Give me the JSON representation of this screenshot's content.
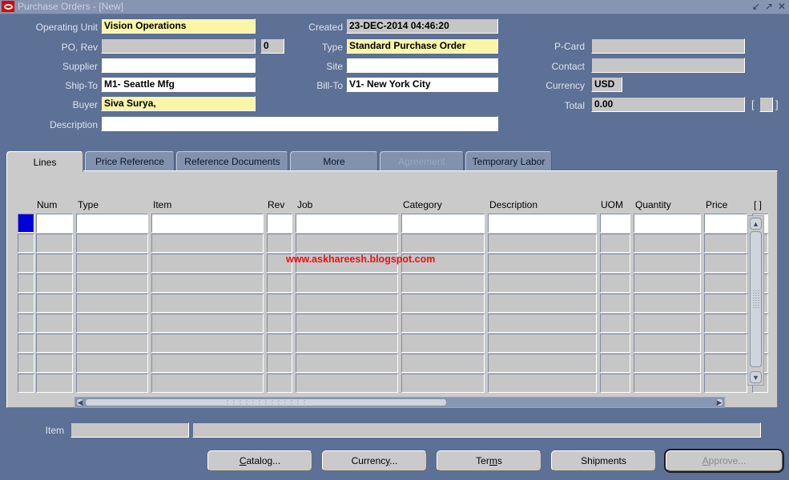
{
  "window": {
    "title": "Purchase Orders - [New]",
    "icon": "oracle-logo-icon",
    "minimize": "↙",
    "maximize": "↗",
    "close": "✕"
  },
  "header": {
    "fields": [
      {
        "label": "Operating Unit",
        "value": "Vision Operations",
        "style": "yellow"
      },
      {
        "label": "PO, Rev",
        "value": "",
        "style": "grey"
      },
      {
        "label": "",
        "value": "0",
        "style": "grey"
      },
      {
        "label": "Supplier",
        "value": "",
        "style": "white"
      },
      {
        "label": "Ship-To",
        "value": "M1- Seattle Mfg",
        "style": "white"
      },
      {
        "label": "Buyer",
        "value": "Siva Surya,",
        "style": "yellow"
      },
      {
        "label": "Description",
        "value": "",
        "style": "white"
      },
      {
        "label": "Created",
        "value": "23-DEC-2014 04:46:20",
        "style": "grey"
      },
      {
        "label": "Type",
        "value": "Standard Purchase Order",
        "style": "yellow"
      },
      {
        "label": "Site",
        "value": "",
        "style": "white"
      },
      {
        "label": "Bill-To",
        "value": "V1- New York City",
        "style": "white"
      },
      {
        "label": "P-Card",
        "value": "",
        "style": "grey"
      },
      {
        "label": "Contact",
        "value": "",
        "style": "grey"
      },
      {
        "label": "Currency",
        "value": "USD",
        "style": "grey"
      },
      {
        "label": "Total",
        "value": "0.00",
        "style": "grey"
      }
    ],
    "bracket_open": "[",
    "bracket_close": "]"
  },
  "tabs": [
    {
      "label": "Lines",
      "active": true,
      "disabled": false
    },
    {
      "label": "Price Reference",
      "active": false,
      "disabled": false
    },
    {
      "label": "Reference Documents",
      "active": false,
      "disabled": false
    },
    {
      "label": "More",
      "active": false,
      "disabled": false
    },
    {
      "label": "Agreement",
      "active": false,
      "disabled": true
    },
    {
      "label": "Temporary Labor",
      "active": false,
      "disabled": false
    }
  ],
  "grid": {
    "columns": [
      "Num",
      "Type",
      "Item",
      "Rev",
      "Job",
      "Category",
      "Description",
      "UOM",
      "Quantity",
      "Price",
      "[ ]"
    ],
    "row_count": 9,
    "active_row_index": 0,
    "rows": [
      [
        "",
        "",
        "",
        "",
        "",
        "",
        "",
        "",
        "",
        "",
        ""
      ],
      [
        "",
        "",
        "",
        "",
        "",
        "",
        "",
        "",
        "",
        "",
        ""
      ],
      [
        "",
        "",
        "",
        "",
        "",
        "",
        "",
        "",
        "",
        "",
        ""
      ],
      [
        "",
        "",
        "",
        "",
        "",
        "",
        "",
        "",
        "",
        "",
        ""
      ],
      [
        "",
        "",
        "",
        "",
        "",
        "",
        "",
        "",
        "",
        "",
        ""
      ],
      [
        "",
        "",
        "",
        "",
        "",
        "",
        "",
        "",
        "",
        "",
        ""
      ],
      [
        "",
        "",
        "",
        "",
        "",
        "",
        "",
        "",
        "",
        "",
        ""
      ],
      [
        "",
        "",
        "",
        "",
        "",
        "",
        "",
        "",
        "",
        "",
        ""
      ],
      [
        "",
        "",
        "",
        "",
        "",
        "",
        "",
        "",
        "",
        "",
        ""
      ]
    ]
  },
  "watermark": "www.askhareesh.blogspot.com",
  "footer": {
    "item_label": "Item",
    "item_value": "",
    "item_desc_value": ""
  },
  "buttons": [
    {
      "label": "Catalog...",
      "mnemonic_index": 0,
      "disabled": false,
      "focused": false
    },
    {
      "label": "Currency...",
      "mnemonic_index": 7,
      "disabled": false,
      "focused": false
    },
    {
      "label": "Terms",
      "mnemonic_index": 3,
      "disabled": false,
      "focused": false
    },
    {
      "label": "Shipments",
      "mnemonic_index": -1,
      "disabled": false,
      "focused": false
    },
    {
      "label": "Approve...",
      "mnemonic_index": 0,
      "disabled": true,
      "focused": true
    }
  ],
  "colors": {
    "window_bg": "#5d7095",
    "titlebar": "#8595b2",
    "canvas": "#cacaca",
    "field_yellow": "#fbf5a8",
    "field_grey": "#c6c6c6",
    "selected_row": "#0000d8",
    "watermark": "#ee1111"
  }
}
